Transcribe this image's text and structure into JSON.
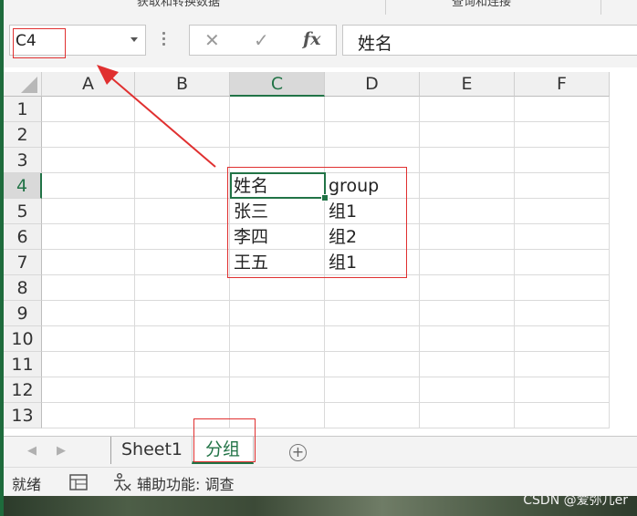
{
  "ribbon": {
    "group_left": "获取和转换数据",
    "group_right": "查询和连接"
  },
  "formula_bar": {
    "name_box": "C4",
    "cancel_icon": "✕",
    "enter_icon": "✓",
    "fx_label": "fx",
    "content": "姓名"
  },
  "columns": [
    "A",
    "B",
    "C",
    "D",
    "E",
    "F"
  ],
  "active_column": "C",
  "rows": [
    "1",
    "2",
    "3",
    "4",
    "5",
    "6",
    "7",
    "8",
    "9",
    "10",
    "11",
    "12",
    "13"
  ],
  "active_row": "4",
  "cells": {
    "C4": "姓名",
    "D4": "group",
    "C5": "张三",
    "D5": "组1",
    "C6": "李四",
    "D6": "组2",
    "C7": "王五",
    "D7": "组1"
  },
  "sheets": {
    "tabs": [
      "Sheet1",
      "分组"
    ],
    "active": "分组",
    "add_icon": "+"
  },
  "status": {
    "ready": "就绪",
    "accessibility": "辅助功能: 调查"
  },
  "watermark": "CSDN @爱弥儿er",
  "colors": {
    "excel_green": "#217346",
    "annotation_red": "#e03030"
  },
  "icons": [
    "cancel-icon",
    "enter-icon",
    "fx-icon",
    "dropdown-icon",
    "add-sheet-icon",
    "sheet-stats-icon",
    "accessibility-icon"
  ]
}
